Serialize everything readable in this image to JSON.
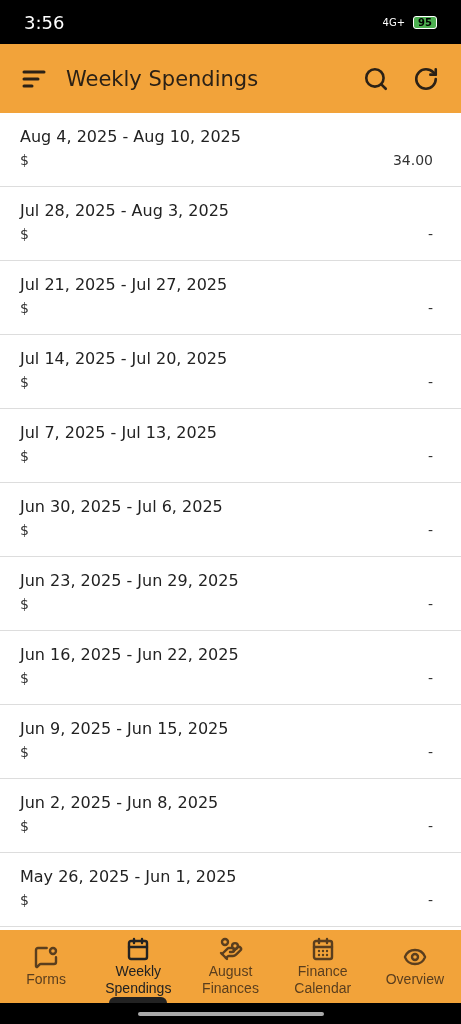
{
  "status_bar": {
    "time": "3:56",
    "network": "4G+",
    "battery": "95"
  },
  "header": {
    "title": "Weekly Spendings"
  },
  "weeks": [
    {
      "range": "Aug 4, 2025 - Aug 10, 2025",
      "currency": "$",
      "amount": "34.00"
    },
    {
      "range": "Jul 28, 2025 - Aug 3, 2025",
      "currency": "$",
      "amount": "-"
    },
    {
      "range": "Jul 21, 2025 - Jul 27, 2025",
      "currency": "$",
      "amount": "-"
    },
    {
      "range": "Jul 14, 2025 - Jul 20, 2025",
      "currency": "$",
      "amount": "-"
    },
    {
      "range": "Jul 7, 2025 - Jul 13, 2025",
      "currency": "$",
      "amount": "-"
    },
    {
      "range": "Jun 30, 2025 - Jul 6, 2025",
      "currency": "$",
      "amount": "-"
    },
    {
      "range": "Jun 23, 2025 - Jun 29, 2025",
      "currency": "$",
      "amount": "-"
    },
    {
      "range": "Jun 16, 2025 - Jun 22, 2025",
      "currency": "$",
      "amount": "-"
    },
    {
      "range": "Jun 9, 2025 - Jun 15, 2025",
      "currency": "$",
      "amount": "-"
    },
    {
      "range": "Jun 2, 2025 - Jun 8, 2025",
      "currency": "$",
      "amount": "-"
    },
    {
      "range": "May 26, 2025 - Jun 1, 2025",
      "currency": "$",
      "amount": "-"
    }
  ],
  "tabs": [
    {
      "kind": "forms",
      "label": "Forms",
      "selected": false
    },
    {
      "kind": "weekly",
      "label": "Weekly\nSpendings",
      "selected": true
    },
    {
      "kind": "hands",
      "label": "August\nFinances",
      "selected": false
    },
    {
      "kind": "calendar",
      "label": "Finance\nCalendar",
      "selected": false
    },
    {
      "kind": "eye",
      "label": "Overview",
      "selected": false
    }
  ]
}
